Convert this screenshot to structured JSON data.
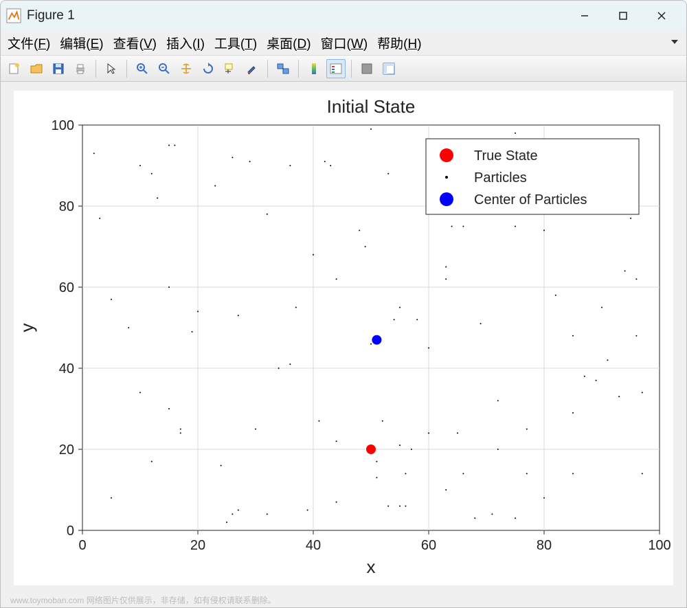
{
  "window": {
    "title": "Figure 1"
  },
  "menu": {
    "file": "文件(F)",
    "edit": "编辑(E)",
    "view": "查看(V)",
    "insert": "插入(I)",
    "tools": "工具(T)",
    "desktop": "桌面(D)",
    "window": "窗口(W)",
    "help": "帮助(H)"
  },
  "watermark": "www.toymoban.com 网络图片仅供展示，非存储，如有侵权请联系删除。",
  "chart_data": {
    "type": "scatter",
    "title": "Initial State",
    "xlabel": "x",
    "ylabel": "y",
    "xlim": [
      0,
      100
    ],
    "ylim": [
      0,
      100
    ],
    "xticks": [
      0,
      20,
      40,
      60,
      80,
      100
    ],
    "yticks": [
      0,
      20,
      40,
      60,
      80,
      100
    ],
    "grid": true,
    "legend": {
      "position": "upper-right-inset",
      "entries": [
        "True State",
        "Particles",
        "Center of Particles"
      ]
    },
    "series": [
      {
        "name": "True State",
        "color": "#ff0000",
        "marker": "circle",
        "size": 14,
        "x": [
          50
        ],
        "y": [
          20
        ]
      },
      {
        "name": "Particles",
        "color": "#000000",
        "marker": "dot",
        "size": 2,
        "x": [
          2,
          3,
          5,
          5,
          8,
          10,
          10,
          12,
          12,
          13,
          15,
          15,
          15,
          16,
          17,
          17,
          19,
          20,
          23,
          24,
          25,
          26,
          26,
          27,
          27,
          29,
          30,
          32,
          32,
          34,
          36,
          36,
          37,
          39,
          40,
          41,
          42,
          43,
          44,
          44,
          44,
          48,
          49,
          50,
          50,
          51,
          51,
          52,
          53,
          53,
          54,
          55,
          55,
          55,
          56,
          56,
          57,
          58,
          60,
          60,
          62,
          63,
          63,
          63,
          64,
          65,
          66,
          66,
          68,
          69,
          71,
          72,
          72,
          75,
          75,
          75,
          77,
          77,
          80,
          80,
          82,
          85,
          85,
          85,
          87,
          89,
          90,
          91,
          92,
          93,
          94,
          95,
          96,
          96,
          97,
          97
        ],
        "y": [
          93,
          77,
          57,
          8,
          50,
          34,
          90,
          88,
          17,
          82,
          95,
          60,
          30,
          95,
          25,
          24,
          49,
          54,
          85,
          16,
          2,
          92,
          4,
          53,
          5,
          91,
          25,
          78,
          4,
          40,
          90,
          41,
          55,
          5,
          68,
          27,
          91,
          90,
          7,
          62,
          22,
          74,
          70,
          99,
          46,
          13,
          17,
          27,
          88,
          6,
          52,
          6,
          55,
          21,
          6,
          14,
          20,
          52,
          45,
          24,
          96,
          10,
          65,
          62,
          75,
          24,
          14,
          75,
          3,
          51,
          4,
          32,
          20,
          98,
          75,
          3,
          25,
          14,
          74,
          8,
          58,
          29,
          48,
          14,
          38,
          37,
          55,
          42,
          93,
          33,
          64,
          77,
          62,
          48,
          14,
          34
        ]
      },
      {
        "name": "Center of Particles",
        "color": "#0000ff",
        "marker": "circle",
        "size": 14,
        "x": [
          51
        ],
        "y": [
          47
        ]
      }
    ]
  }
}
